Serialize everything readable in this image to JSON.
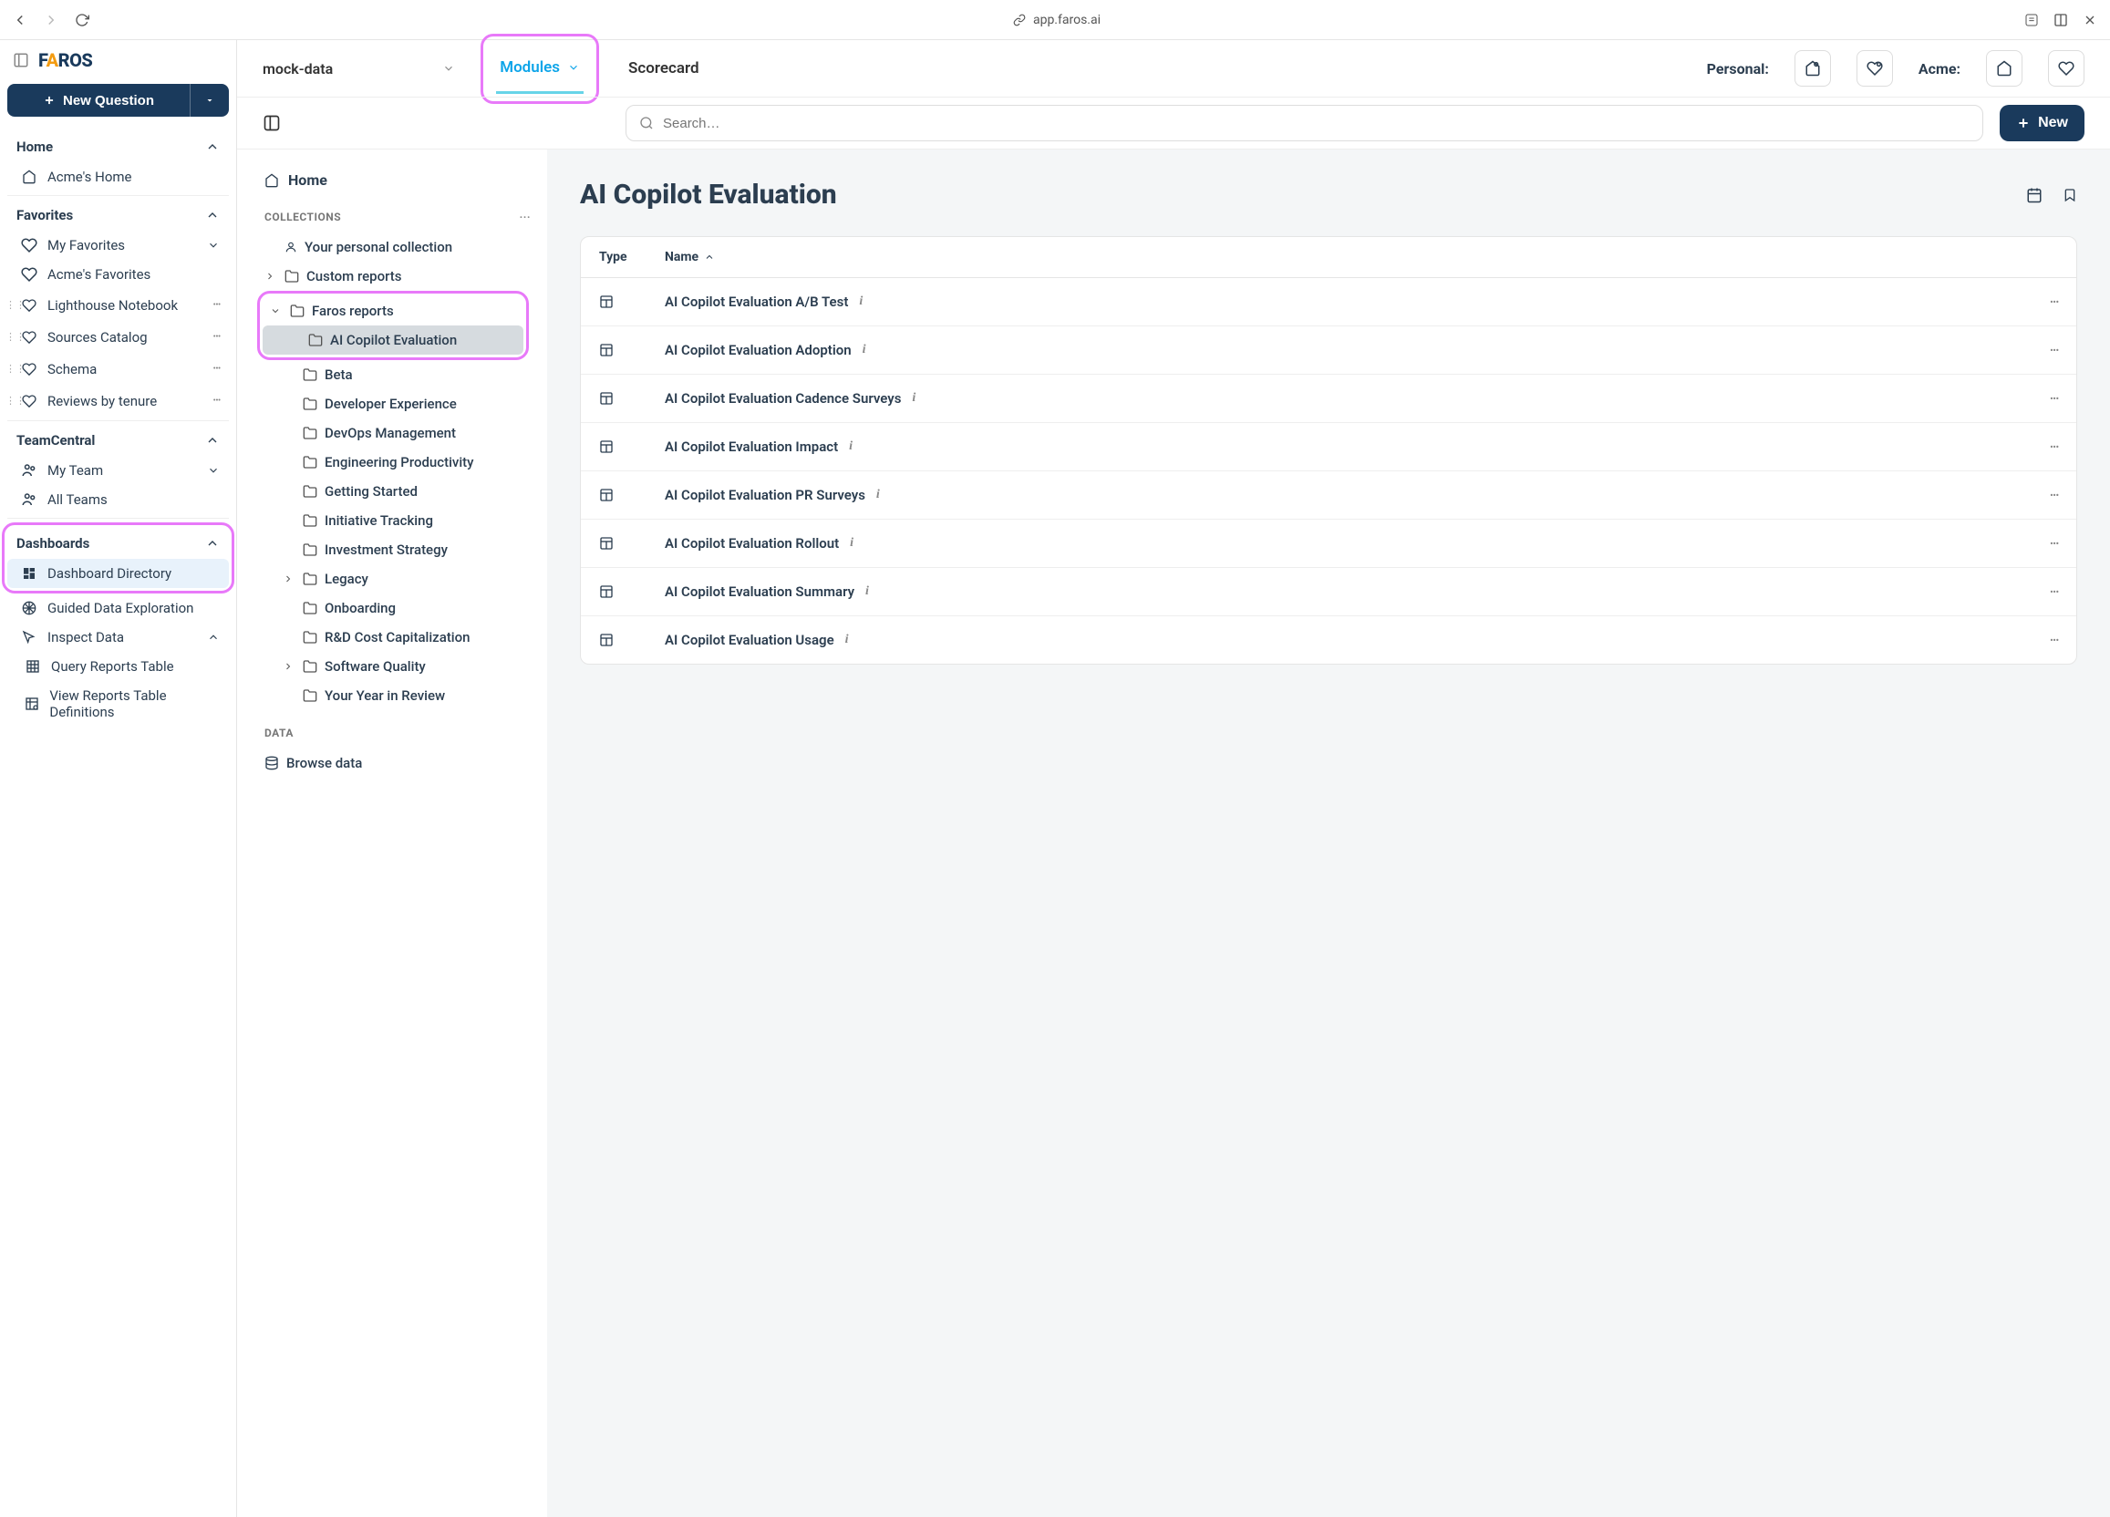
{
  "browser": {
    "url": "app.faros.ai"
  },
  "logo": {
    "text_pre": "F",
    "text_a": "A",
    "text_post": "ROS"
  },
  "sidebar": {
    "new_question_label": "New Question",
    "sections": {
      "home": {
        "title": "Home",
        "items": [
          "Acme's Home"
        ]
      },
      "favorites": {
        "title": "Favorites",
        "my_favorites": "My Favorites",
        "acme_favorites": "Acme's Favorites",
        "drag_items": [
          "Lighthouse Notebook",
          "Sources Catalog",
          "Schema",
          "Reviews by tenure"
        ]
      },
      "teamcentral": {
        "title": "TeamCentral",
        "my_team": "My Team",
        "all_teams": "All Teams"
      },
      "dashboards": {
        "title": "Dashboards",
        "directory": "Dashboard Directory",
        "guided": "Guided Data Exploration",
        "inspect": "Inspect Data",
        "query_reports": "Query Reports Table",
        "view_reports": "View Reports Table Definitions"
      }
    }
  },
  "topbar": {
    "data_source": "mock-data",
    "tabs": {
      "modules": "Modules",
      "scorecard": "Scorecard"
    },
    "personal_label": "Personal:",
    "acme_label": "Acme:"
  },
  "secondbar": {
    "search_placeholder": "Search…",
    "new_label": "New"
  },
  "collections": {
    "home": "Home",
    "label": "COLLECTIONS",
    "data_label": "DATA",
    "browse_data": "Browse data",
    "personal_collection": "Your personal collection",
    "custom_reports": "Custom reports",
    "faros_reports": "Faros reports",
    "faros_children": [
      "AI Copilot Evaluation",
      "Beta",
      "Developer Experience",
      "DevOps Management",
      "Engineering Productivity",
      "Getting Started",
      "Initiative Tracking",
      "Investment Strategy",
      "Legacy",
      "Onboarding",
      "R&D Cost Capitalization",
      "Software Quality",
      "Your Year in Review"
    ]
  },
  "detail": {
    "title": "AI Copilot Evaluation",
    "columns": {
      "type": "Type",
      "name": "Name"
    },
    "rows": [
      "AI Copilot Evaluation A/B Test",
      "AI Copilot Evaluation Adoption",
      "AI Copilot Evaluation Cadence Surveys",
      "AI Copilot Evaluation Impact",
      "AI Copilot Evaluation PR Surveys",
      "AI Copilot Evaluation Rollout",
      "AI Copilot Evaluation Summary",
      "AI Copilot Evaluation Usage"
    ]
  }
}
